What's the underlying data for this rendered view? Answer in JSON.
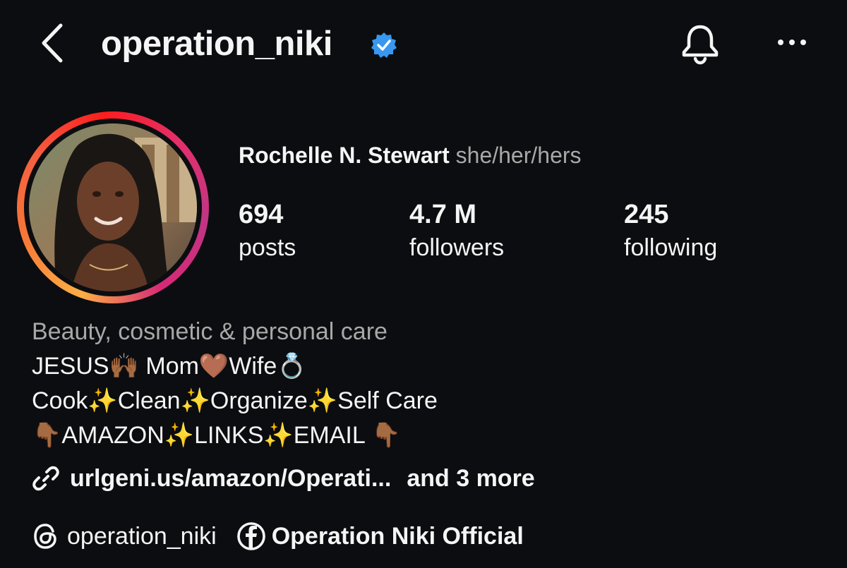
{
  "header": {
    "username": "operation_niki",
    "verified": true
  },
  "profile": {
    "name": "Rochelle N. Stewart",
    "pronouns": "she/her/hers",
    "stats": [
      {
        "value": "694",
        "label": "posts"
      },
      {
        "value": "4.7 M",
        "label": "followers"
      },
      {
        "value": "245",
        "label": "following"
      }
    ]
  },
  "bio": {
    "category": "Beauty, cosmetic & personal care",
    "lines": [
      "JESUS🙌🏾 Mom🤎Wife💍",
      "Cook✨Clean✨Organize✨Self Care",
      "👇🏾AMAZON✨LINKS✨EMAIL 👇🏾"
    ],
    "link": "urlgeni.us/amazon/Operati...",
    "link_more": "and 3 more"
  },
  "social": {
    "threads": "operation_niki",
    "facebook": "Operation Niki Official"
  },
  "colors": {
    "background": "#0c0d10",
    "text": "#f5f5f5",
    "secondary_text": "#a8a8a8",
    "verified_blue": "#3897f0",
    "story_ring": [
      "#fcaf45",
      "#f56040",
      "#e1306c",
      "#c13584"
    ]
  },
  "icons": {
    "back": "chevron-left-icon",
    "notifications": "bell-icon",
    "more": "more-horizontal-icon",
    "link": "link-icon",
    "threads": "threads-icon",
    "facebook": "facebook-icon"
  }
}
